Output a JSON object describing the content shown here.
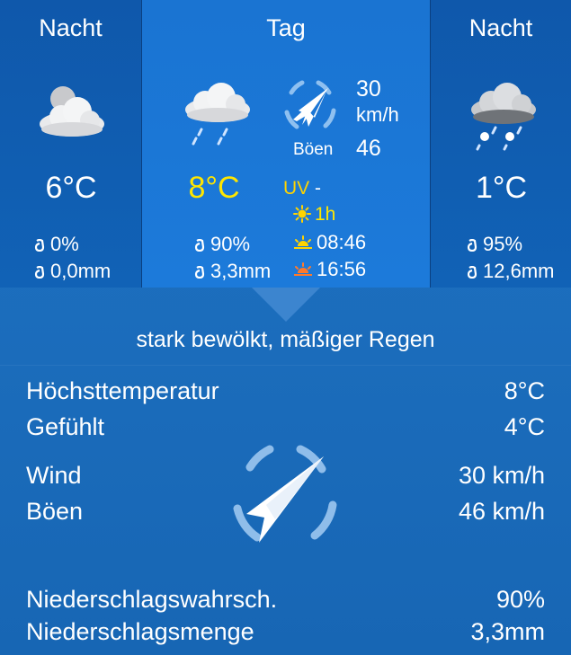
{
  "left": {
    "title": "Nacht",
    "temperature": "6°C",
    "precip_probability": "0%",
    "precip_amount": "0,0mm",
    "icon": "moon-cloud-icon"
  },
  "day": {
    "title": "Tag",
    "temperature": "8°C",
    "temperature_color": "#ffe600",
    "precip_probability": "90%",
    "precip_amount": "3,3mm",
    "icon": "cloud-rain-icon",
    "wind_speed": "30",
    "wind_unit": "km/h",
    "gusts_label": "Böen",
    "gusts_value": "46",
    "uv_label": "UV",
    "uv_value": "-",
    "sun_hours": "1h",
    "sunrise": "08:46",
    "sunset": "16:56",
    "accent_color": "#ffd400"
  },
  "right": {
    "title": "Nacht",
    "temperature": "1°C",
    "precip_probability": "95%",
    "precip_amount": "12,6mm",
    "icon": "cloud-sleet-icon"
  },
  "details": {
    "description": "stark bewölkt, mäßiger Regen",
    "rows": [
      {
        "label": "Höchsttemperatur",
        "value": "8°C"
      },
      {
        "label": "Gefühlt",
        "value": "4°C"
      },
      {
        "label": "Wind",
        "value": "30 km/h"
      },
      {
        "label": "Böen",
        "value": "46 km/h"
      },
      {
        "label": "Niederschlagswahrsch.",
        "value": "90%"
      },
      {
        "label": "Niederschlagsmenge",
        "value": "3,3mm"
      }
    ],
    "wind_icon": "wind-direction-icon"
  }
}
